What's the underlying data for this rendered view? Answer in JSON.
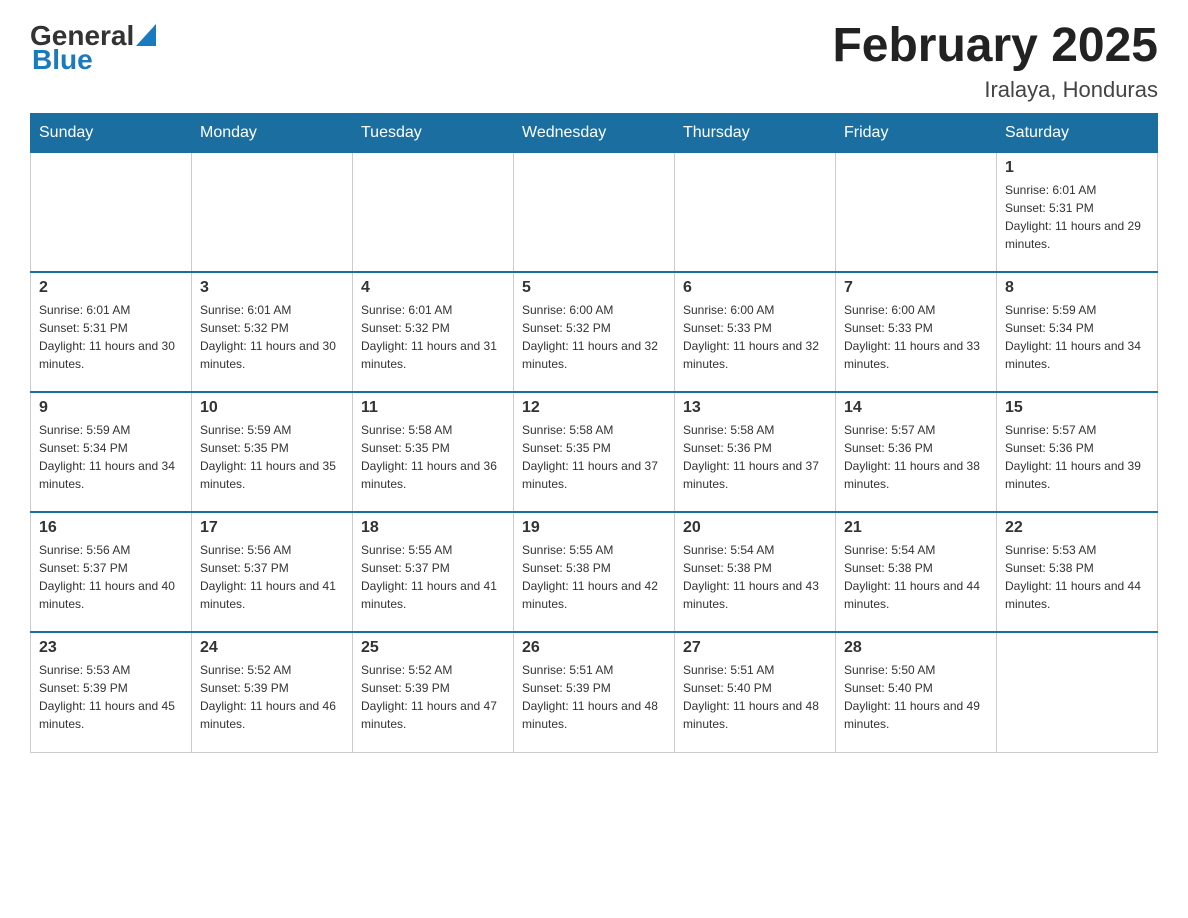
{
  "logo": {
    "general": "General",
    "blue": "Blue"
  },
  "title": {
    "month": "February 2025",
    "location": "Iralaya, Honduras"
  },
  "weekdays": [
    "Sunday",
    "Monday",
    "Tuesday",
    "Wednesday",
    "Thursday",
    "Friday",
    "Saturday"
  ],
  "weeks": [
    [
      {
        "day": "",
        "sunrise": "",
        "sunset": "",
        "daylight": ""
      },
      {
        "day": "",
        "sunrise": "",
        "sunset": "",
        "daylight": ""
      },
      {
        "day": "",
        "sunrise": "",
        "sunset": "",
        "daylight": ""
      },
      {
        "day": "",
        "sunrise": "",
        "sunset": "",
        "daylight": ""
      },
      {
        "day": "",
        "sunrise": "",
        "sunset": "",
        "daylight": ""
      },
      {
        "day": "",
        "sunrise": "",
        "sunset": "",
        "daylight": ""
      },
      {
        "day": "1",
        "sunrise": "Sunrise: 6:01 AM",
        "sunset": "Sunset: 5:31 PM",
        "daylight": "Daylight: 11 hours and 29 minutes."
      }
    ],
    [
      {
        "day": "2",
        "sunrise": "Sunrise: 6:01 AM",
        "sunset": "Sunset: 5:31 PM",
        "daylight": "Daylight: 11 hours and 30 minutes."
      },
      {
        "day": "3",
        "sunrise": "Sunrise: 6:01 AM",
        "sunset": "Sunset: 5:32 PM",
        "daylight": "Daylight: 11 hours and 30 minutes."
      },
      {
        "day": "4",
        "sunrise": "Sunrise: 6:01 AM",
        "sunset": "Sunset: 5:32 PM",
        "daylight": "Daylight: 11 hours and 31 minutes."
      },
      {
        "day": "5",
        "sunrise": "Sunrise: 6:00 AM",
        "sunset": "Sunset: 5:32 PM",
        "daylight": "Daylight: 11 hours and 32 minutes."
      },
      {
        "day": "6",
        "sunrise": "Sunrise: 6:00 AM",
        "sunset": "Sunset: 5:33 PM",
        "daylight": "Daylight: 11 hours and 32 minutes."
      },
      {
        "day": "7",
        "sunrise": "Sunrise: 6:00 AM",
        "sunset": "Sunset: 5:33 PM",
        "daylight": "Daylight: 11 hours and 33 minutes."
      },
      {
        "day": "8",
        "sunrise": "Sunrise: 5:59 AM",
        "sunset": "Sunset: 5:34 PM",
        "daylight": "Daylight: 11 hours and 34 minutes."
      }
    ],
    [
      {
        "day": "9",
        "sunrise": "Sunrise: 5:59 AM",
        "sunset": "Sunset: 5:34 PM",
        "daylight": "Daylight: 11 hours and 34 minutes."
      },
      {
        "day": "10",
        "sunrise": "Sunrise: 5:59 AM",
        "sunset": "Sunset: 5:35 PM",
        "daylight": "Daylight: 11 hours and 35 minutes."
      },
      {
        "day": "11",
        "sunrise": "Sunrise: 5:58 AM",
        "sunset": "Sunset: 5:35 PM",
        "daylight": "Daylight: 11 hours and 36 minutes."
      },
      {
        "day": "12",
        "sunrise": "Sunrise: 5:58 AM",
        "sunset": "Sunset: 5:35 PM",
        "daylight": "Daylight: 11 hours and 37 minutes."
      },
      {
        "day": "13",
        "sunrise": "Sunrise: 5:58 AM",
        "sunset": "Sunset: 5:36 PM",
        "daylight": "Daylight: 11 hours and 37 minutes."
      },
      {
        "day": "14",
        "sunrise": "Sunrise: 5:57 AM",
        "sunset": "Sunset: 5:36 PM",
        "daylight": "Daylight: 11 hours and 38 minutes."
      },
      {
        "day": "15",
        "sunrise": "Sunrise: 5:57 AM",
        "sunset": "Sunset: 5:36 PM",
        "daylight": "Daylight: 11 hours and 39 minutes."
      }
    ],
    [
      {
        "day": "16",
        "sunrise": "Sunrise: 5:56 AM",
        "sunset": "Sunset: 5:37 PM",
        "daylight": "Daylight: 11 hours and 40 minutes."
      },
      {
        "day": "17",
        "sunrise": "Sunrise: 5:56 AM",
        "sunset": "Sunset: 5:37 PM",
        "daylight": "Daylight: 11 hours and 41 minutes."
      },
      {
        "day": "18",
        "sunrise": "Sunrise: 5:55 AM",
        "sunset": "Sunset: 5:37 PM",
        "daylight": "Daylight: 11 hours and 41 minutes."
      },
      {
        "day": "19",
        "sunrise": "Sunrise: 5:55 AM",
        "sunset": "Sunset: 5:38 PM",
        "daylight": "Daylight: 11 hours and 42 minutes."
      },
      {
        "day": "20",
        "sunrise": "Sunrise: 5:54 AM",
        "sunset": "Sunset: 5:38 PM",
        "daylight": "Daylight: 11 hours and 43 minutes."
      },
      {
        "day": "21",
        "sunrise": "Sunrise: 5:54 AM",
        "sunset": "Sunset: 5:38 PM",
        "daylight": "Daylight: 11 hours and 44 minutes."
      },
      {
        "day": "22",
        "sunrise": "Sunrise: 5:53 AM",
        "sunset": "Sunset: 5:38 PM",
        "daylight": "Daylight: 11 hours and 44 minutes."
      }
    ],
    [
      {
        "day": "23",
        "sunrise": "Sunrise: 5:53 AM",
        "sunset": "Sunset: 5:39 PM",
        "daylight": "Daylight: 11 hours and 45 minutes."
      },
      {
        "day": "24",
        "sunrise": "Sunrise: 5:52 AM",
        "sunset": "Sunset: 5:39 PM",
        "daylight": "Daylight: 11 hours and 46 minutes."
      },
      {
        "day": "25",
        "sunrise": "Sunrise: 5:52 AM",
        "sunset": "Sunset: 5:39 PM",
        "daylight": "Daylight: 11 hours and 47 minutes."
      },
      {
        "day": "26",
        "sunrise": "Sunrise: 5:51 AM",
        "sunset": "Sunset: 5:39 PM",
        "daylight": "Daylight: 11 hours and 48 minutes."
      },
      {
        "day": "27",
        "sunrise": "Sunrise: 5:51 AM",
        "sunset": "Sunset: 5:40 PM",
        "daylight": "Daylight: 11 hours and 48 minutes."
      },
      {
        "day": "28",
        "sunrise": "Sunrise: 5:50 AM",
        "sunset": "Sunset: 5:40 PM",
        "daylight": "Daylight: 11 hours and 49 minutes."
      },
      {
        "day": "",
        "sunrise": "",
        "sunset": "",
        "daylight": ""
      }
    ]
  ]
}
